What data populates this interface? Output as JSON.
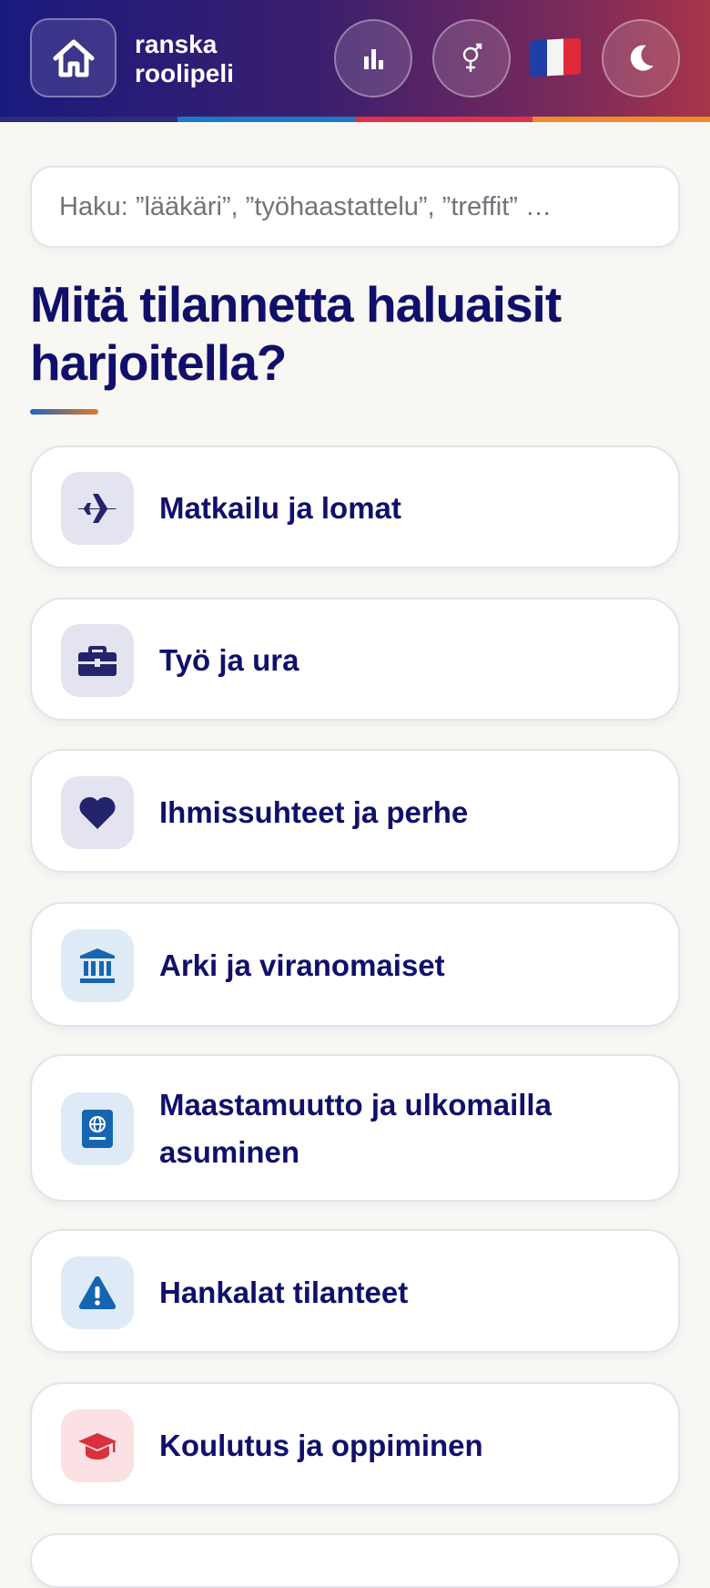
{
  "header": {
    "title_line1": "ranska",
    "title_line2": "roolipeli",
    "stripe_colors": [
      "#2b2d7a",
      "#1e78c8",
      "#e0314a",
      "#f08a2a"
    ],
    "flag_colors": [
      "#1f3fa6",
      "#f4f4f4",
      "#e02a3a"
    ]
  },
  "search": {
    "placeholder": "Haku: ”lääkäri”, ”työhaastattelu”, ”treffit” …"
  },
  "heading": "Mitä tilannetta haluaisit harjoitella?",
  "categories": [
    {
      "label": "Matkailu ja lomat",
      "icon": "airplane-icon",
      "icon_bg": "#e4e4f1",
      "icon_color": "#23236e"
    },
    {
      "label": "Työ ja ura",
      "icon": "briefcase-icon",
      "icon_bg": "#e4e4f1",
      "icon_color": "#23236e"
    },
    {
      "label": "Ihmissuhteet ja perhe",
      "icon": "heart-icon",
      "icon_bg": "#e4e4f1",
      "icon_color": "#23236e"
    },
    {
      "label": "Arki ja viranomaiset",
      "icon": "government-building-icon",
      "icon_bg": "#deebf7",
      "icon_color": "#1565b0"
    },
    {
      "label": "Maastamuutto ja ulkomailla asuminen",
      "icon": "passport-icon",
      "icon_bg": "#deebf7",
      "icon_color": "#1565b0"
    },
    {
      "label": "Hankalat tilanteet",
      "icon": "warning-icon",
      "icon_bg": "#deebf7",
      "icon_color": "#1565b0"
    },
    {
      "label": "Koulutus ja oppiminen",
      "icon": "graduation-cap-icon",
      "icon_bg": "#fbe1e4",
      "icon_color": "#d8313f"
    }
  ]
}
